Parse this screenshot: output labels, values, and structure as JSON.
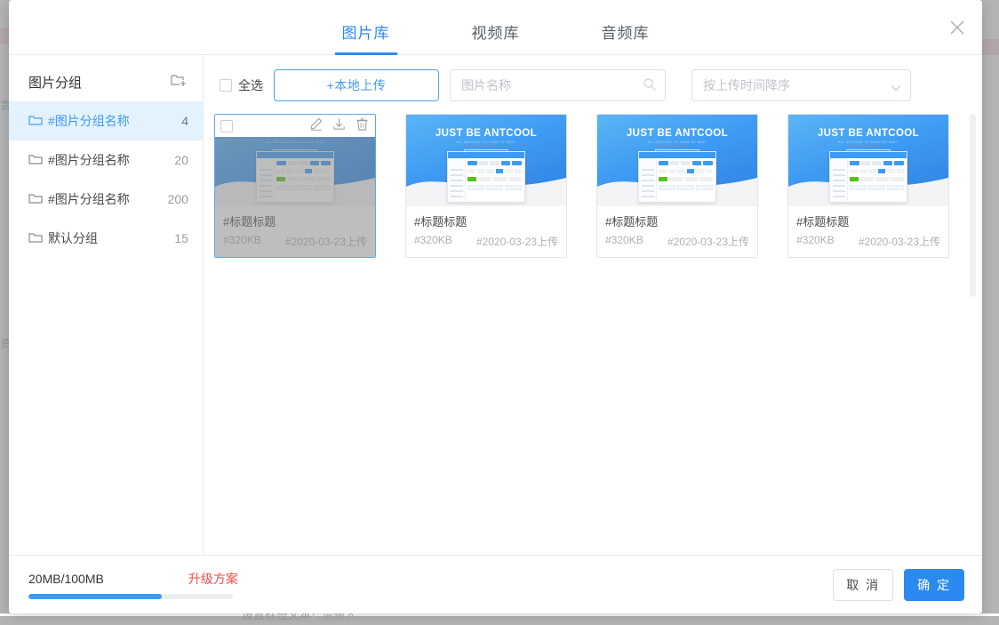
{
  "modal": {
    "tabs": [
      {
        "label": "图片库",
        "active": true
      },
      {
        "label": "视频库",
        "active": false
      },
      {
        "label": "音频库",
        "active": false
      }
    ],
    "close_icon": "close-icon"
  },
  "sidebar": {
    "title": "图片分组",
    "add_icon": "add-folder-icon",
    "items": [
      {
        "label": "#图片分组名称",
        "count": "4",
        "active": true
      },
      {
        "label": "#图片分组名称",
        "count": "20",
        "active": false
      },
      {
        "label": "#图片分组名称",
        "count": "200",
        "active": false
      },
      {
        "label": "默认分组",
        "count": "15",
        "active": false
      }
    ]
  },
  "toolbar": {
    "select_all_label": "全选",
    "upload_label": "+本地上传",
    "search_placeholder": "图片名称",
    "search_value": "",
    "search_icon": "search-icon",
    "sort_value": "按上传时间降序",
    "sort_icon": "chevron-down-icon",
    "sort_options": [
      "按上传时间降序"
    ]
  },
  "gallery": {
    "banner_title": "JUST BE ANTCOOL",
    "banner_subtitle": "ALL ANTCOOL TO LOOK UP BEST",
    "items": [
      {
        "title": "#标题标题",
        "size": "#320KB",
        "date": "#2020-03-23上传",
        "selected": true
      },
      {
        "title": "#标题标题",
        "size": "#320KB",
        "date": "#2020-03-23上传",
        "selected": false
      },
      {
        "title": "#标题标题",
        "size": "#320KB",
        "date": "#2020-03-23上传",
        "selected": false
      },
      {
        "title": "#标题标题",
        "size": "#320KB",
        "date": "#2020-03-23上传",
        "selected": false
      }
    ],
    "card_actions": {
      "edit_icon": "pencil-icon",
      "download_icon": "download-icon",
      "delete_icon": "trash-icon"
    }
  },
  "footer": {
    "storage_text": "20MB/100MB",
    "storage_percent": 65,
    "upgrade_label": "升级方案",
    "cancel_label": "取 消",
    "confirm_label": "确 定"
  },
  "background": {
    "left_text_1": "言",
    "left_text_2": "资",
    "bottom_text_1": "设置标签文本",
    "bottom_text_2": "请输入"
  },
  "colors": {
    "accent": "#2a8af0",
    "accent_light": "#3d9bf5",
    "danger": "#f04b4b",
    "active_bg": "#e3f2fd",
    "border": "#e4e4e4"
  }
}
